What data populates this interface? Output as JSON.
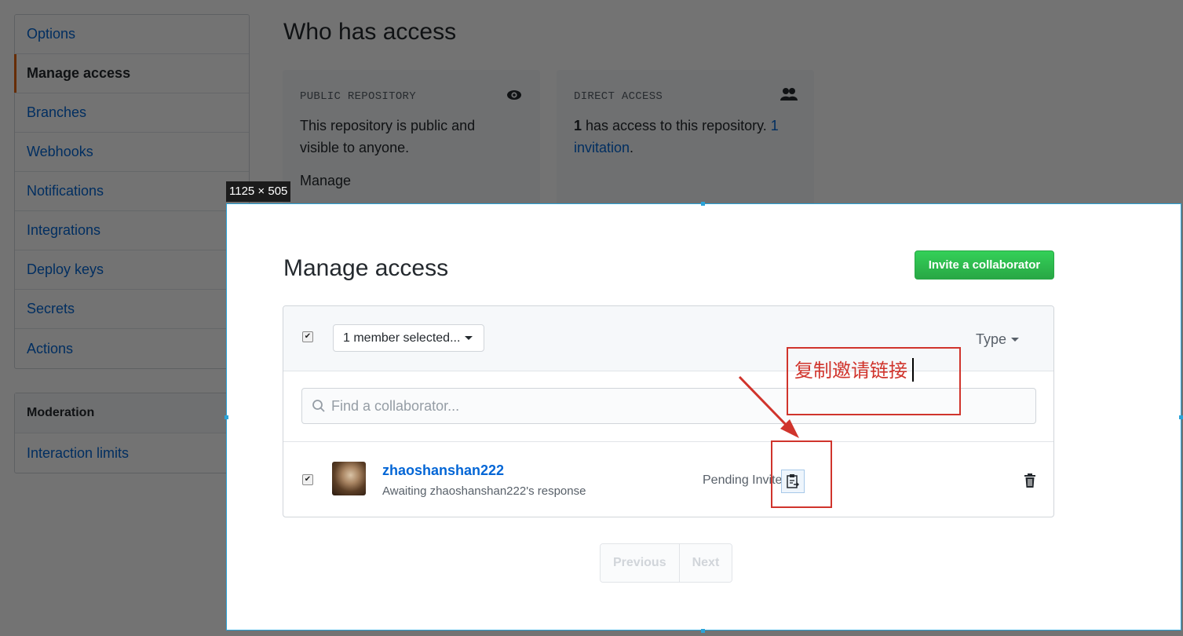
{
  "sidebar": {
    "items": [
      {
        "label": "Options"
      },
      {
        "label": "Manage access"
      },
      {
        "label": "Branches"
      },
      {
        "label": "Webhooks"
      },
      {
        "label": "Notifications"
      },
      {
        "label": "Integrations"
      },
      {
        "label": "Deploy keys"
      },
      {
        "label": "Secrets"
      },
      {
        "label": "Actions"
      }
    ],
    "moderation_heading": "Moderation",
    "moderation_item": "Interaction limits"
  },
  "who_has_access": {
    "title": "Who has access",
    "public": {
      "label": "PUBLIC REPOSITORY",
      "text": "This repository is public and visible to anyone.",
      "link": "Manage"
    },
    "direct": {
      "label": "DIRECT ACCESS",
      "count": "1",
      "text": " has access to this repository. ",
      "link": "1 invitation",
      "suffix": "."
    }
  },
  "overlay": {
    "size_label": "1125 × 505"
  },
  "manage_access": {
    "title": "Manage access",
    "invite_button": "Invite a collaborator",
    "selector_label": "1 member selected...",
    "type_filter": "Type",
    "search_placeholder": "Find a collaborator...",
    "member": {
      "username": "zhaoshanshan222",
      "status_line": "Awaiting zhaoshanshan222's response",
      "pending_label": "Pending Invite"
    },
    "pagination": {
      "previous": "Previous",
      "next": "Next"
    }
  },
  "annotation": {
    "text": "复制邀请链接",
    "color": "#d0342c"
  },
  "colors": {
    "link": "#0366d6",
    "invite_green": "#28a745",
    "active_marker": "#e36209",
    "frame": "#2aa3d8"
  }
}
